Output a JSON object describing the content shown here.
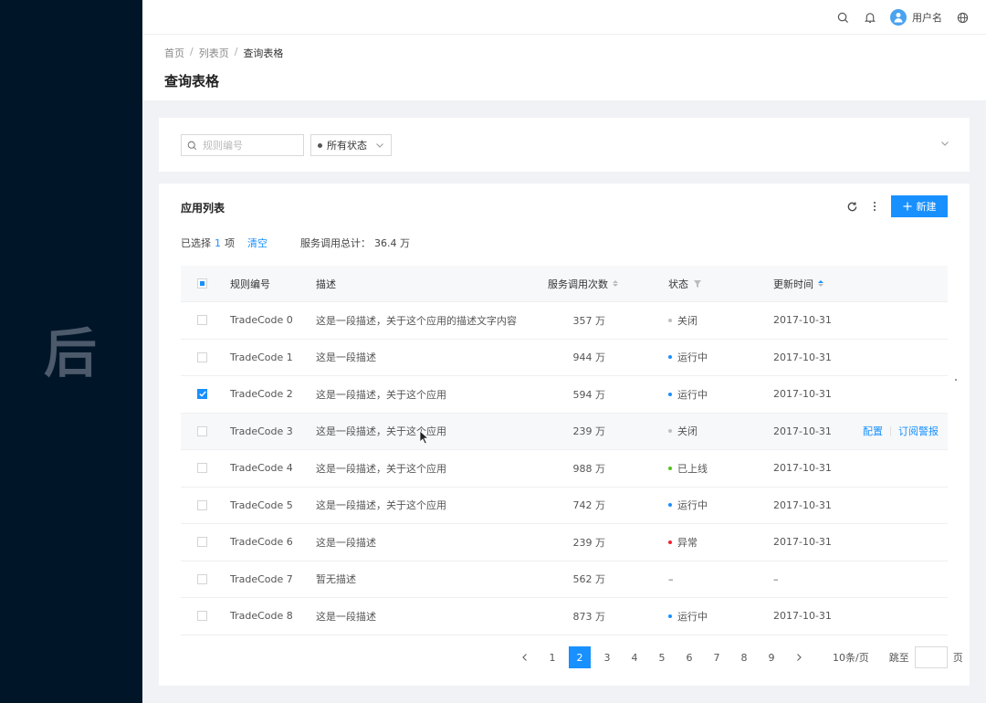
{
  "sider": {
    "brand_char": "后"
  },
  "header": {
    "username": "用户名"
  },
  "breadcrumb": [
    "首页",
    "列表页",
    "查询表格"
  ],
  "page_title": "查询表格",
  "search": {
    "placeholder": "规则编号",
    "status_selected": "所有状态"
  },
  "table_card": {
    "title": "应用列表",
    "new_button": "新建",
    "summary": {
      "selected_prefix": "已选择",
      "selected_count": "1",
      "selected_suffix": "项",
      "clear": "清空",
      "total_label": "服务调用总计：",
      "total_value": "36.4 万"
    }
  },
  "columns": [
    "规则编号",
    "描述",
    "服务调用次数",
    "状态",
    "更新时间"
  ],
  "status_colors": {
    "关闭": "#bfbfbf",
    "运行中": "#1890ff",
    "已上线": "#52c41a",
    "异常": "#f5222d"
  },
  "rows": [
    {
      "code": "TradeCode 0",
      "desc": "这是一段描述，关于这个应用的描述文字内容",
      "calls": "357 万",
      "status": "关闭",
      "updated": "2017-10-31",
      "checked": false
    },
    {
      "code": "TradeCode 1",
      "desc": "这是一段描述",
      "calls": "944 万",
      "status": "运行中",
      "updated": "2017-10-31",
      "checked": false
    },
    {
      "code": "TradeCode 2",
      "desc": "这是一段描述，关于这个应用",
      "calls": "594 万",
      "status": "运行中",
      "updated": "2017-10-31",
      "checked": true
    },
    {
      "code": "TradeCode 3",
      "desc": "这是一段描述，关于这个应用",
      "calls": "239 万",
      "status": "关闭",
      "updated": "2017-10-31",
      "checked": false,
      "actions": [
        "配置",
        "订阅警报"
      ]
    },
    {
      "code": "TradeCode 4",
      "desc": "这是一段描述，关于这个应用",
      "calls": "988 万",
      "status": "已上线",
      "updated": "2017-10-31",
      "checked": false
    },
    {
      "code": "TradeCode 5",
      "desc": "这是一段描述，关于这个应用",
      "calls": "742 万",
      "status": "运行中",
      "updated": "2017-10-31",
      "checked": false
    },
    {
      "code": "TradeCode 6",
      "desc": "这是一段描述",
      "calls": "239 万",
      "status": "异常",
      "updated": "2017-10-31",
      "checked": false
    },
    {
      "code": "TradeCode 7",
      "desc": "暂无描述",
      "calls": "562 万",
      "status": "–",
      "updated": "–",
      "checked": false
    },
    {
      "code": "TradeCode 8",
      "desc": "这是一段描述",
      "calls": "873 万",
      "status": "运行中",
      "updated": "2017-10-31",
      "checked": false
    }
  ],
  "pagination": {
    "pages": [
      "1",
      "2",
      "3",
      "4",
      "5",
      "6",
      "7",
      "8",
      "9"
    ],
    "current": "2",
    "page_size": "10条/页",
    "jump_label": "跳至",
    "jump_suffix": "页"
  }
}
